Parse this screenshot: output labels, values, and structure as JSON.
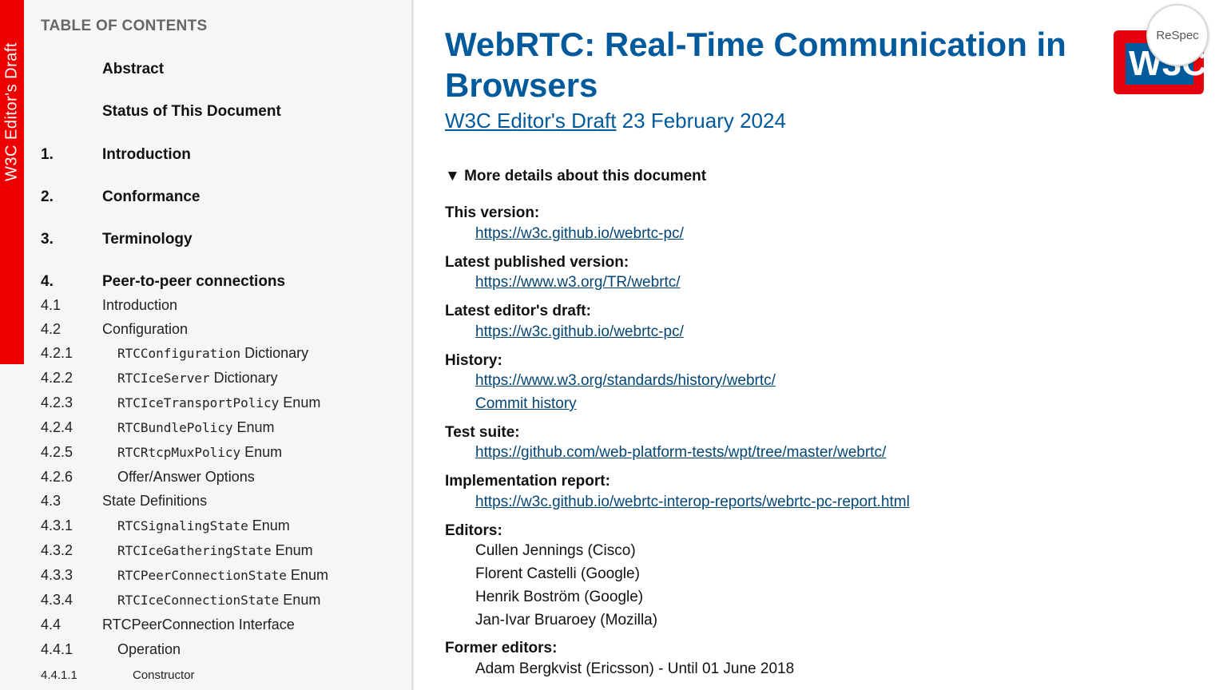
{
  "banner": "W3C Editor's Draft",
  "toc": {
    "heading": "TABLE OF CONTENTS",
    "items": [
      {
        "num": "",
        "text": "Abstract"
      },
      {
        "num": "",
        "text": "Status of This Document"
      },
      {
        "num": "1.",
        "text": "Introduction"
      },
      {
        "num": "2.",
        "text": "Conformance"
      },
      {
        "num": "3.",
        "text": "Terminology"
      },
      {
        "num": "4.",
        "text": "Peer-to-peer connections"
      },
      {
        "num": "4.1",
        "text": "Introduction"
      },
      {
        "num": "4.2",
        "text": "Configuration"
      },
      {
        "num": "4.2.1",
        "code": "RTCConfiguration",
        "text": " Dictionary"
      },
      {
        "num": "4.2.2",
        "code": "RTCIceServer",
        "text": " Dictionary"
      },
      {
        "num": "4.2.3",
        "code": "RTCIceTransportPolicy",
        "text": " Enum"
      },
      {
        "num": "4.2.4",
        "code": "RTCBundlePolicy",
        "text": " Enum"
      },
      {
        "num": "4.2.5",
        "code": "RTCRtcpMuxPolicy",
        "text": " Enum"
      },
      {
        "num": "4.2.6",
        "text": "Offer/Answer Options"
      },
      {
        "num": "4.3",
        "text": "State Definitions"
      },
      {
        "num": "4.3.1",
        "code": "RTCSignalingState",
        "text": " Enum"
      },
      {
        "num": "4.3.2",
        "code": "RTCIceGatheringState",
        "text": " Enum"
      },
      {
        "num": "4.3.3",
        "code": "RTCPeerConnectionState",
        "text": " Enum"
      },
      {
        "num": "4.3.4",
        "code": "RTCIceConnectionState",
        "text": " Enum"
      },
      {
        "num": "4.4",
        "text": "RTCPeerConnection Interface"
      },
      {
        "num": "4.4.1",
        "text": "Operation"
      },
      {
        "num": "4.4.1.1",
        "text": "Constructor"
      }
    ]
  },
  "main": {
    "title": "WebRTC: Real-Time Communication in Browsers",
    "subtitle_link": "W3C Editor's Draft",
    "subtitle_date": " 23 February 2024",
    "details_summary": "More details about this document",
    "details_marker": "▼",
    "this_version_label": "This version:",
    "this_version_url": "https://w3c.github.io/webrtc-pc/",
    "latest_published_label": "Latest published version:",
    "latest_published_url": "https://www.w3.org/TR/webrtc/",
    "latest_draft_label": "Latest editor's draft:",
    "latest_draft_url": "https://w3c.github.io/webrtc-pc/",
    "history_label": "History:",
    "history_url": "https://www.w3.org/standards/history/webrtc/",
    "commit_history": "Commit history",
    "test_suite_label": "Test suite:",
    "test_suite_url": "https://github.com/web-platform-tests/wpt/tree/master/webrtc/",
    "impl_report_label": "Implementation report:",
    "impl_report_url": "https://w3c.github.io/webrtc-interop-reports/webrtc-pc-report.html",
    "editors_label": "Editors:",
    "editors": [
      "Cullen Jennings (Cisco)",
      "Florent Castelli (Google)",
      "Henrik Boström (Google)",
      "Jan-Ivar Bruaroey (Mozilla)"
    ],
    "former_editors_label": "Former editors:",
    "former_editors": [
      "Adam Bergkvist (Ericsson) - Until 01 June 2018"
    ]
  },
  "logo": {
    "text": "W3C",
    "brand_red": "#e5000d",
    "brand_blue": "#005a9c"
  },
  "respec_label": "ReSpec",
  "colors": {
    "heading_blue": "#005a9c",
    "link_blue": "#034575",
    "banner_red": "#ee0000"
  }
}
